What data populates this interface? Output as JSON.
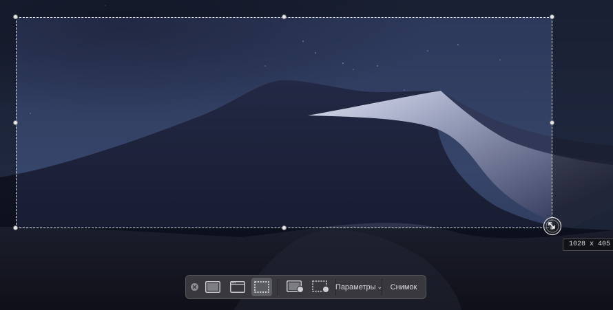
{
  "background": {
    "name": "Mojave night dune wallpaper",
    "sky_color": "#2b3654",
    "dune_color": "#1b2036"
  },
  "selection": {
    "border_style": "dashed",
    "border_color": "#ffffff"
  },
  "dimensions_label": "1028 x 405",
  "toolbar": {
    "close_icon": "close-circle-icon",
    "capture_entire_screen_icon": "screen-icon",
    "capture_window_icon": "window-icon",
    "capture_selection_icon": "dashed-rect-icon",
    "record_entire_screen_icon": "screen-record-icon",
    "record_selection_icon": "dashed-rect-record-icon",
    "options_label": "Параметры",
    "options_chevron": "⌄",
    "capture_label": "Снимок",
    "selected_tool": "capture_selection"
  }
}
